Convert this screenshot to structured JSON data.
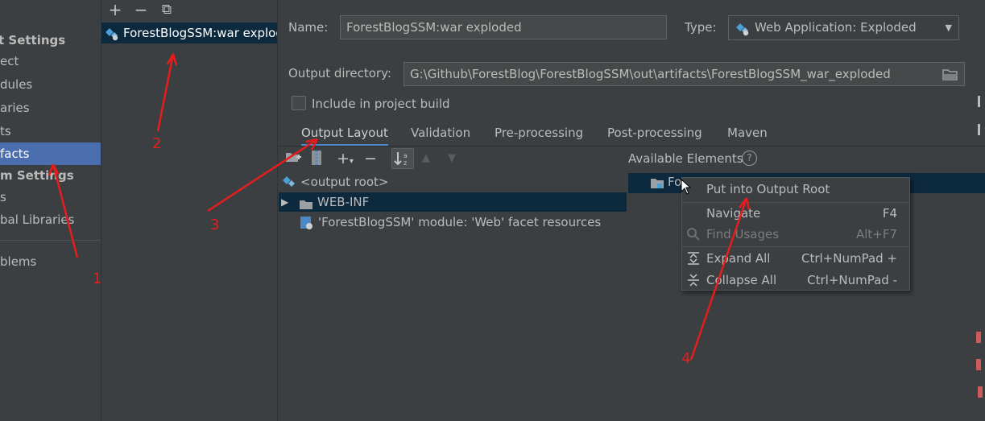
{
  "sidebar": {
    "project_settings_header": "t Settings",
    "items": [
      {
        "label": "ect"
      },
      {
        "label": "dules"
      },
      {
        "label": "aries"
      },
      {
        "label": "ts"
      },
      {
        "label": "facts"
      }
    ],
    "platform_settings_header": "m Settings",
    "platform_items": [
      {
        "label": "s"
      },
      {
        "label": "bal Libraries"
      }
    ],
    "problems_label": "blems"
  },
  "artifacts": {
    "toolbar": {
      "add": "+",
      "remove": "−",
      "copy": "⧉"
    },
    "selected": "ForestBlogSSM:war explod"
  },
  "detail": {
    "name_label": "Name:",
    "name_value": "ForestBlogSSM:war exploded",
    "type_label": "Type:",
    "type_value": "Web Application: Exploded",
    "output_dir_label": "Output directory:",
    "output_dir_value": "G:\\Github\\ForestBlog\\ForestBlogSSM\\out\\artifacts\\ForestBlogSSM_war_exploded",
    "include_label": "Include in project build",
    "tabs": [
      {
        "label": "Output Layout"
      },
      {
        "label": "Validation"
      },
      {
        "label": "Pre-processing"
      },
      {
        "label": "Post-processing"
      },
      {
        "label": "Maven"
      }
    ],
    "available_label": "Available Elements",
    "tree": [
      {
        "label": "<output root>"
      },
      {
        "label": "WEB-INF"
      },
      {
        "label": "'ForestBlogSSM' module: 'Web' facet resources"
      }
    ],
    "available_item": "Fo"
  },
  "context_menu": {
    "items": [
      {
        "label": "Put into Output Root",
        "shortcut": ""
      },
      {
        "label": "Navigate",
        "shortcut": "F4"
      },
      {
        "label": "Find Usages",
        "shortcut": "Alt+F7"
      },
      {
        "label": "Expand All",
        "shortcut": "Ctrl+NumPad +"
      },
      {
        "label": "Collapse All",
        "shortcut": "Ctrl+NumPad -"
      }
    ]
  },
  "annotations": [
    "1",
    "2",
    "3",
    "4"
  ],
  "colors": {
    "accent": "#4b6eaf",
    "selection": "#0d293e",
    "annotation": "#e51d1d"
  }
}
